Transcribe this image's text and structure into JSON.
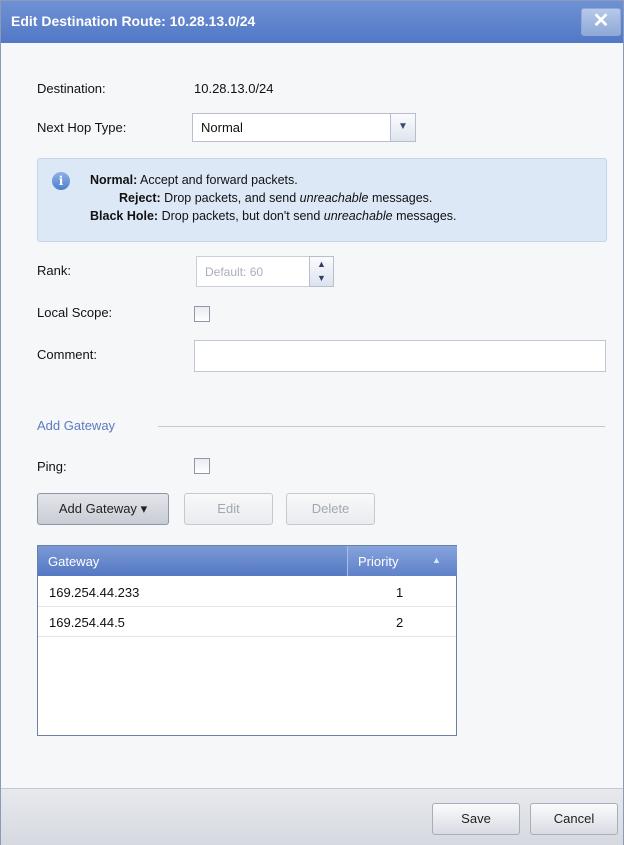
{
  "dialog": {
    "title": "Edit Destination Route: 10.28.13.0/24",
    "close_glyph": "✕"
  },
  "form": {
    "destination_label": "Destination:",
    "destination_value": "10.28.13.0/24",
    "next_hop_label": "Next Hop Type:",
    "next_hop_value": "Normal",
    "info": {
      "normal_term": "Normal:",
      "normal_text": " Accept and forward packets.",
      "reject_term": "Reject:",
      "reject_text_a": " Drop packets, and send ",
      "reject_text_em": "unreachable",
      "reject_text_b": " messages.",
      "blackhole_term": "Black Hole:",
      "blackhole_text_a": " Drop packets, but don't send ",
      "blackhole_text_em": "unreachable",
      "blackhole_text_b": " messages."
    },
    "rank_label": "Rank:",
    "rank_placeholder": "Default: 60",
    "local_scope_label": "Local Scope:",
    "local_scope_checked": false,
    "comment_label": "Comment:",
    "comment_value": ""
  },
  "gateway_section": {
    "title": "Add Gateway",
    "ping_label": "Ping:",
    "ping_checked": false,
    "add_button": "Add Gateway",
    "add_button_caret": "▾",
    "edit_button": "Edit",
    "delete_button": "Delete",
    "columns": [
      "Gateway",
      "Priority"
    ],
    "sort_glyph": "▲",
    "rows": [
      {
        "gateway": "169.254.44.233",
        "priority": "1"
      },
      {
        "gateway": "169.254.44.5",
        "priority": "2"
      }
    ]
  },
  "footer": {
    "save_button": "Save",
    "cancel_button": "Cancel"
  },
  "icons": {
    "info": "info-icon",
    "close": "close-icon",
    "chevron_down": "chevron-down-icon"
  },
  "colors": {
    "titlebar": "#5278c6",
    "info_background": "#dde8f7",
    "section_title": "#5a7cc2",
    "grid_header": "#5478c3"
  }
}
